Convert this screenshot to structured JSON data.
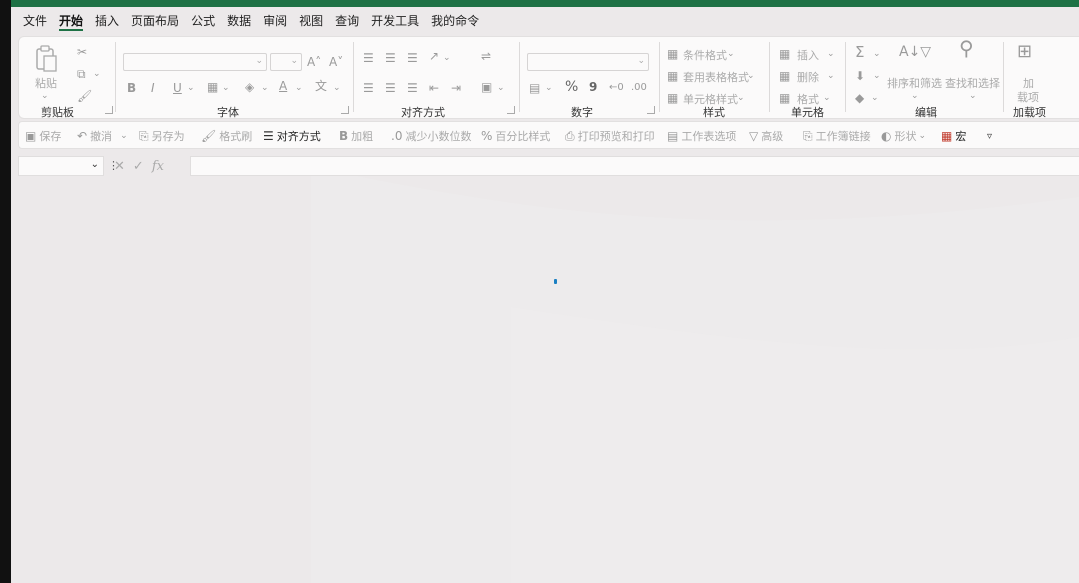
{
  "tabs": [
    "文件",
    "开始",
    "插入",
    "页面布局",
    "公式",
    "数据",
    "审阅",
    "视图",
    "查询",
    "开发工具",
    "我的命令"
  ],
  "active_tab_index": 1,
  "ribbon": {
    "clipboard": {
      "label": "剪贴板",
      "paste": "粘贴"
    },
    "font": {
      "label": "字体",
      "bold": "B",
      "italic": "I",
      "underline": "U",
      "grow": "A˄",
      "shrink": "A˅"
    },
    "alignment": {
      "label": "对齐方式"
    },
    "number": {
      "label": "数字",
      "percent": "%",
      "comma": "9"
    },
    "styles": {
      "label": "样式",
      "conditional": "条件格式",
      "table_format": "套用表格格式",
      "cell_style": "单元格样式"
    },
    "cells": {
      "label": "单元格",
      "insert": "插入",
      "delete": "删除",
      "format": "格式"
    },
    "editing": {
      "label": "编辑",
      "sort_filter": "排序和筛选",
      "find_select": "查找和选择"
    },
    "addins": {
      "label": "加载项",
      "addins_btn_line1": "加",
      "addins_btn_line2": "载项"
    }
  },
  "qat": {
    "save": "保存",
    "undo": "撤消",
    "save_as": "另存为",
    "format_painter": "格式刷",
    "align": "对齐方式",
    "bold": "加粗",
    "decrease_decimal": "减少小数位数",
    "percent_style": "百分比样式",
    "print_preview": "打印预览和打印",
    "sheet_options": "工作表选项",
    "advanced": "高级",
    "sheet_link": "工作簿链接",
    "shapes": "形状",
    "macro": "宏"
  },
  "formula_bar": {
    "fx": "fx",
    "cancel": "✕",
    "enter": "✓",
    "name_box_value": "",
    "formula_value": ""
  },
  "colors": {
    "accent": "#1e7145",
    "background": "#ece9ea",
    "panel": "#fbfafa"
  }
}
